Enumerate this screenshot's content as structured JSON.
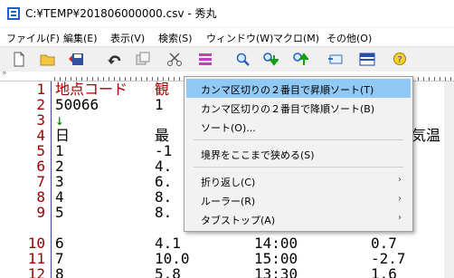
{
  "window": {
    "title": "C:¥TEMP¥201806000000.csv - 秀丸"
  },
  "menu": [
    {
      "label": "ファイル(F)"
    },
    {
      "label": "編集(E)"
    },
    {
      "label": "表示(V)"
    },
    {
      "label": "検索(S)"
    },
    {
      "label": "ウィンドウ(W)"
    },
    {
      "label": "マクロ(M)"
    },
    {
      "label": "その他(O)"
    }
  ],
  "toolbar": {
    "icons": [
      "new-file-icon",
      "open-folder-icon",
      "save-icon",
      "undo-icon",
      "copy-icon",
      "cut-icon",
      "paste-icon",
      "search-icon",
      "search-down-icon",
      "search-up-icon",
      "switch-window-icon",
      "split-window-icon",
      "help-icon"
    ]
  },
  "ruler": {
    "mark": "»"
  },
  "editor": {
    "lines": [
      {
        "num": "1",
        "c1": "地点コード",
        "c2": "観",
        "c3": "",
        "c4": ""
      },
      {
        "num": "2",
        "c1": "50066",
        "c2": "1",
        "c3": "",
        "c4": ""
      },
      {
        "num": "3",
        "c1": "↓",
        "c2": "",
        "c3": "",
        "c4": ""
      },
      {
        "num": "4",
        "c1": "日",
        "c2": "最",
        "c3": "",
        "c4": "気温"
      },
      {
        "num": "5",
        "c1": "1",
        "c2": "-1",
        "c3": "",
        "c4": ""
      },
      {
        "num": "6",
        "c1": "2",
        "c2": "4.",
        "c3": "",
        "c4": ""
      },
      {
        "num": "7",
        "c1": "3",
        "c2": "6.",
        "c3": "",
        "c4": ""
      },
      {
        "num": "8",
        "c1": "4",
        "c2": "8.",
        "c3": "",
        "c4": ""
      },
      {
        "num": "9",
        "c1": "5",
        "c2": "8.",
        "c3": "",
        "c4": ""
      },
      {
        "num": "10",
        "c1": "6",
        "c2": "4.1",
        "c3": "14:00",
        "c4": "0.7"
      },
      {
        "num": "11",
        "c1": "7",
        "c2": "10.0",
        "c3": "15:00",
        "c4": "-2.7"
      },
      {
        "num": "12",
        "c1": "8",
        "c2": "5.8",
        "c3": "13:30",
        "c4": "1.6"
      }
    ]
  },
  "context_menu": {
    "items": [
      {
        "label": "カンマ区切りの２番目で昇順ソート(T)",
        "highlighted": true
      },
      {
        "label": "カンマ区切りの２番目で降順ソート(B)"
      },
      {
        "label": "ソート(O)..."
      },
      {
        "label": "境界をここまで狭める(S)"
      },
      {
        "label": "折り返し(C)",
        "arrow": "›"
      },
      {
        "label": "ルーラー(R)",
        "arrow": "›"
      },
      {
        "label": "タブストップ(A)",
        "arrow": "›"
      }
    ]
  },
  "colors": {
    "line_number": "#a00000",
    "highlight": "#90c8f6",
    "gutter_line": "#4040a0"
  }
}
